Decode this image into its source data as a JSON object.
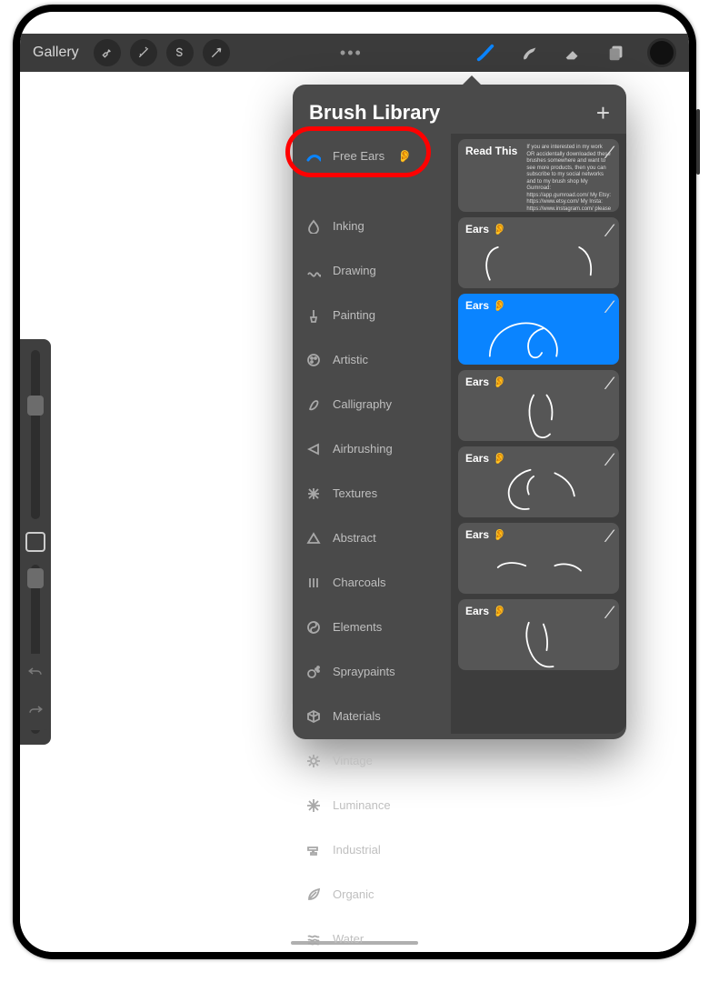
{
  "toolbar": {
    "gallery_label": "Gallery",
    "menu_dots": "•••"
  },
  "popover": {
    "title": "Brush Library"
  },
  "categories": [
    {
      "label": "Free Ears",
      "emoji": "👂",
      "icon": "stroke",
      "selected": true,
      "highlighted": true
    },
    {
      "label": "Inking",
      "icon": "drop"
    },
    {
      "label": "Drawing",
      "icon": "squiggle"
    },
    {
      "label": "Painting",
      "icon": "pbrush"
    },
    {
      "label": "Artistic",
      "icon": "palette"
    },
    {
      "label": "Calligraphy",
      "icon": "calli"
    },
    {
      "label": "Airbrushing",
      "icon": "air"
    },
    {
      "label": "Textures",
      "icon": "texture"
    },
    {
      "label": "Abstract",
      "icon": "triangle"
    },
    {
      "label": "Charcoals",
      "icon": "bars"
    },
    {
      "label": "Elements",
      "icon": "yin"
    },
    {
      "label": "Spraypaints",
      "icon": "spray"
    },
    {
      "label": "Materials",
      "icon": "cube"
    },
    {
      "label": "Vintage",
      "icon": "gear"
    },
    {
      "label": "Luminance",
      "icon": "spark"
    },
    {
      "label": "Industrial",
      "icon": "anvil"
    },
    {
      "label": "Organic",
      "icon": "leaf"
    },
    {
      "label": "Water",
      "icon": "waves"
    }
  ],
  "brushes": [
    {
      "label": "Read This",
      "emoji": "",
      "info": "If you are interested in my work OR accidentally downloaded these brushes somewhere and want to see more products, then you can subscribe to my social networks and to my brush shop My Gumroad: https://app.gumroad.com/ My Etsy: https://www.etsy.com/ My Insta: https://www.instagram.com/ please subscribe ♥",
      "kind": "readthis"
    },
    {
      "label": "Ears",
      "emoji": "👂",
      "preview": "ear1"
    },
    {
      "label": "Ears",
      "emoji": "👂",
      "preview": "ear2",
      "selected": true
    },
    {
      "label": "Ears",
      "emoji": "👂",
      "preview": "ear3"
    },
    {
      "label": "Ears",
      "emoji": "👂",
      "preview": "ear4"
    },
    {
      "label": "Ears",
      "emoji": "👂",
      "preview": "ear5"
    },
    {
      "label": "Ears",
      "emoji": "👂",
      "preview": "ear6"
    }
  ]
}
